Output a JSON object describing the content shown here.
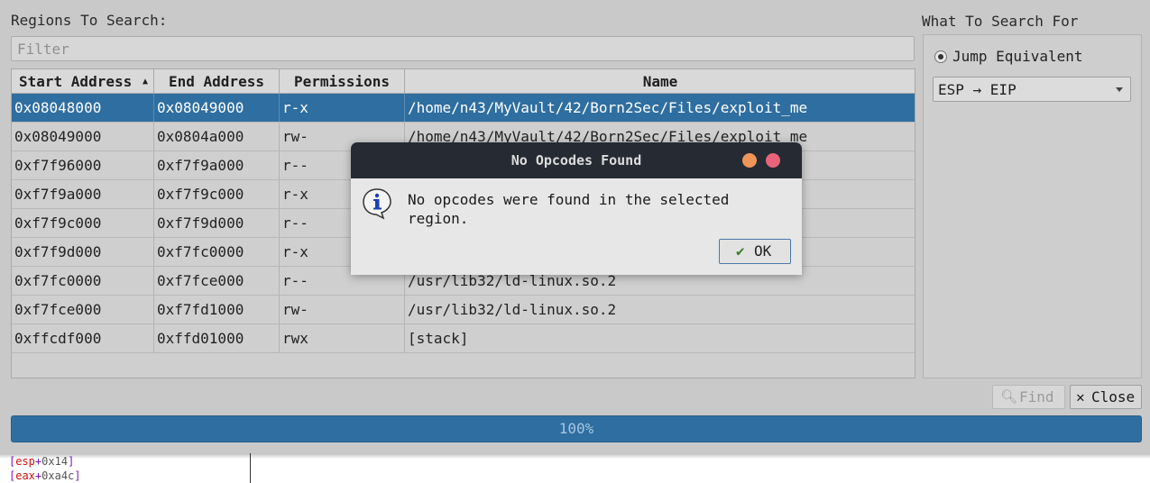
{
  "regions": {
    "title": "Regions To Search:",
    "filter_placeholder": "Filter",
    "columns": [
      "Start Address",
      "End Address",
      "Permissions",
      "Name"
    ],
    "rows": [
      {
        "start": "0x08048000",
        "end": "0x08049000",
        "perm": "r-x",
        "name": "/home/n43/MyVault/42/Born2Sec/Files/exploit_me",
        "selected": true
      },
      {
        "start": "0x08049000",
        "end": "0x0804a000",
        "perm": "rw-",
        "name": "/home/n43/MyVault/42/Born2Sec/Files/exploit_me",
        "selected": false
      },
      {
        "start": "0xf7f96000",
        "end": "0xf7f9a000",
        "perm": "r--",
        "name": "",
        "selected": false
      },
      {
        "start": "0xf7f9a000",
        "end": "0xf7f9c000",
        "perm": "r-x",
        "name": "",
        "selected": false
      },
      {
        "start": "0xf7f9c000",
        "end": "0xf7f9d000",
        "perm": "r--",
        "name": "",
        "selected": false
      },
      {
        "start": "0xf7f9d000",
        "end": "0xf7fc0000",
        "perm": "r-x",
        "name": "",
        "selected": false
      },
      {
        "start": "0xf7fc0000",
        "end": "0xf7fce000",
        "perm": "r--",
        "name": "/usr/lib32/ld-linux.so.2",
        "selected": false
      },
      {
        "start": "0xf7fce000",
        "end": "0xf7fd1000",
        "perm": "rw-",
        "name": "/usr/lib32/ld-linux.so.2",
        "selected": false
      },
      {
        "start": "0xffcdf000",
        "end": "0xffd01000",
        "perm": "rwx",
        "name": "[stack]",
        "selected": false
      }
    ]
  },
  "search_for": {
    "title": "What To Search For",
    "radio_label": "Jump Equivalent",
    "combo_value": "ESP → EIP"
  },
  "buttons": {
    "find": "Find",
    "close": "Close"
  },
  "progress": {
    "value": 100,
    "text": "100%"
  },
  "dialog": {
    "title": "No Opcodes Found",
    "message_line1": "No opcodes were found in the selected",
    "message_line2": "region.",
    "ok": "OK"
  },
  "background": {
    "line1": {
      "open": "[",
      "reg": "esp",
      "plus": "+",
      "off": "0x14",
      "close": "]"
    },
    "line2": {
      "open": "[",
      "reg": "eax",
      "plus": "+",
      "off": "0xa4c",
      "close": "]"
    }
  },
  "colors": {
    "selection": "#2f6ea0",
    "titlebar": "#252a33",
    "minimize_dot": "#f0955a",
    "close_dot": "#e8637a"
  }
}
